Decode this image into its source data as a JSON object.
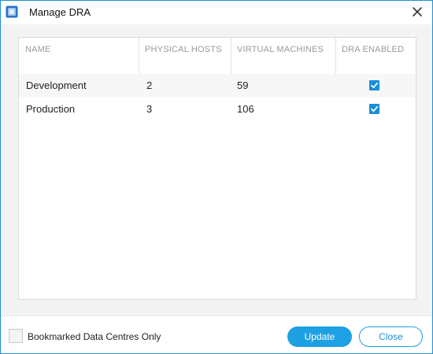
{
  "window": {
    "title": "Manage DRA"
  },
  "table": {
    "columns": [
      "NAME",
      "PHYSICAL HOSTS",
      "VIRTUAL MACHINES",
      "DRA ENABLED"
    ],
    "rows": [
      {
        "name": "Development",
        "physical_hosts": "2",
        "virtual_machines": "59",
        "dra_enabled": true
      },
      {
        "name": "Production",
        "physical_hosts": "3",
        "virtual_machines": "106",
        "dra_enabled": true
      }
    ]
  },
  "footer": {
    "bookmarked_label": "Bookmarked Data Centres Only",
    "bookmarked_checked": false,
    "update_label": "Update",
    "close_label": "Close"
  },
  "colors": {
    "accent": "#1da1e2",
    "checkbox": "#1a8fd8",
    "window_border": "#1e90d6"
  }
}
